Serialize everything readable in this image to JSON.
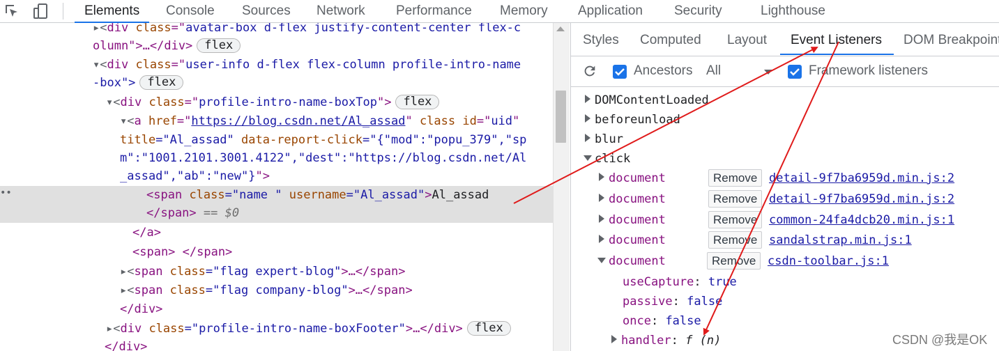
{
  "toolbar": {
    "inspect_icon": "inspect-element-icon",
    "device_icon": "device-toolbar-icon",
    "tabs": [
      "Elements",
      "Console",
      "Sources",
      "Network",
      "Performance",
      "Memory",
      "Application",
      "Security",
      "Lighthouse"
    ],
    "active_tab": "Elements"
  },
  "elements": {
    "l0": {
      "pre": "▸<",
      "tag": "div",
      "attr": " class",
      "eq": "=\"",
      "val": "avatar-box d-flex justify-content-center flex-c"
    },
    "l1": {
      "text": "olumn\">…</div>",
      "badge": "flex"
    },
    "l2": {
      "pre": "▾<",
      "tag": "div",
      "attr": " class",
      "eq": "=\"",
      "val": "user-info d-flex flex-column profile-intro-name"
    },
    "l3": {
      "text": "-box\">",
      "badge": "flex"
    },
    "l4": {
      "pre": "▾<",
      "tag": "div",
      "attr": " class",
      "eq": "=\"",
      "val": "profile-intro-name-boxTop",
      "close": "\">",
      "badge": "flex"
    },
    "l5": {
      "pre": "▾<",
      "tag": "a",
      "attr1": " href",
      "link": "https://blog.csdn.net/Al_assad",
      "attr2": " class id",
      "eq2": "=\"",
      "val2": "uid",
      "end": "\""
    },
    "l6": {
      "attr": "title",
      "val": "=\"Al_assad\"",
      "attr2": " data-report-click",
      "val2": "=\"{\"mod\":\"popu_379\",\"sp"
    },
    "l7": {
      "val": "m\":\"1001.2101.3001.4122\",\"dest\":\"https://blog.csdn.net/Al"
    },
    "l8": {
      "val": "_assad\",\"ab\":\"new\"}",
      "close": "\">"
    },
    "l9": {
      "open": "<",
      "tag": "span",
      "attr1": " class",
      "val1": "=\"name \"",
      "attr2": " username",
      "val2": "=\"Al_assad\"",
      "close": ">",
      "text": "Al_assad"
    },
    "l10": {
      "close_tag": "</span>",
      "suffix": " == $0"
    },
    "l11": {
      "text": "</a>"
    },
    "l12": {
      "text": "<span> </span>"
    },
    "l13": {
      "pre": "▸<",
      "tag": "span",
      "attr": " class",
      "val": "=\"flag expert-blog\"",
      "rest": ">…</span>"
    },
    "l14": {
      "pre": "▸<",
      "tag": "span",
      "attr": " class",
      "val": "=\"flag company-blog\"",
      "rest": ">…</span>"
    },
    "l15": {
      "text": "</div>"
    },
    "l16": {
      "pre": "▸<",
      "tag": "div",
      "attr": " class",
      "val": "=\"profile-intro-name-boxFooter\"",
      "rest": ">…</div>",
      "badge": "flex"
    },
    "l17": {
      "text": "</div>"
    },
    "dots": "••"
  },
  "side": {
    "tabs": [
      "Styles",
      "Computed",
      "Layout",
      "Event Listeners",
      "DOM Breakpoints"
    ],
    "active_tab": "Event Listeners",
    "ancestors_label": "Ancestors",
    "ancestors_checked": true,
    "filter_value": "All",
    "framework_label": "Framework listeners",
    "framework_checked": true,
    "events": [
      "DOMContentLoaded",
      "beforeunload",
      "blur",
      "click"
    ],
    "listener_target": "document",
    "remove_label": "Remove",
    "sources": [
      "detail-9f7ba6959d.min.js:2",
      "detail-9f7ba6959d.min.js:2",
      "common-24fa4dcb20.min.js:1",
      "sandalstrap.min.js:1",
      "csdn-toolbar.js:1"
    ],
    "props": [
      {
        "key": "useCapture",
        "val": "true"
      },
      {
        "key": "passive",
        "val": "false"
      },
      {
        "key": "once",
        "val": "false"
      }
    ],
    "handler_key": "handler",
    "handler_val": "f (n)"
  },
  "colors": {
    "accent": "#1a73e8",
    "annotation": "#e01b1b"
  },
  "watermark": "CSDN @我是OK"
}
